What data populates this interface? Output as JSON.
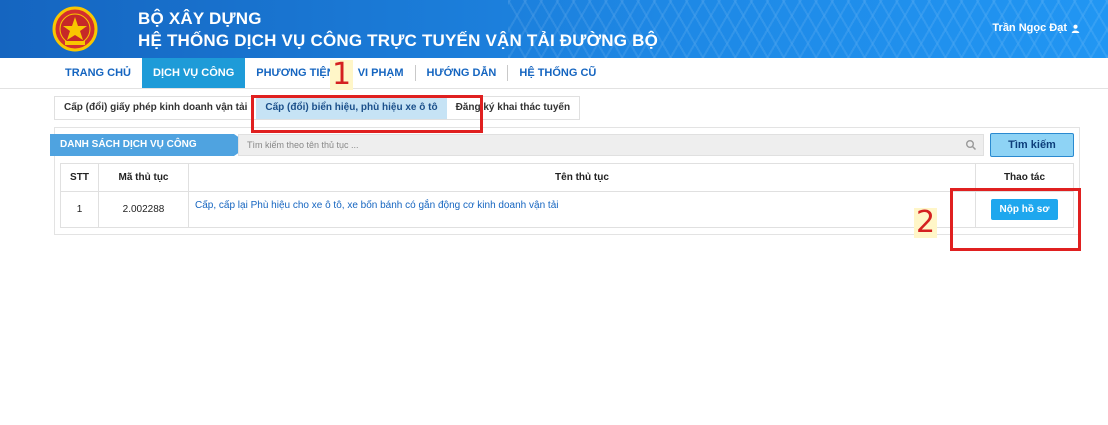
{
  "header": {
    "title_line1": "BỘ XÂY DỰNG",
    "title_line2": "HỆ THỐNG DỊCH VỤ CÔNG TRỰC TUYẾN VẬN TẢI ĐƯỜNG BỘ",
    "user_name": "Trần Ngọc Đạt",
    "user_icon": "user-icon",
    "emblem_icon": "national-emblem-icon"
  },
  "nav": {
    "items": [
      {
        "label": "TRANG CHỦ"
      },
      {
        "label": "DỊCH VỤ CÔNG",
        "active": true
      },
      {
        "label": "PHƯƠNG TIỆN"
      },
      {
        "label": "VI PHẠM"
      },
      {
        "label": "HƯỚNG DẪN"
      },
      {
        "label": "HỆ THỐNG CŨ"
      }
    ]
  },
  "tabs": [
    {
      "label": "Cấp (đổi) giấy phép kinh doanh vận tải"
    },
    {
      "label": "Cấp (đổi) biển hiệu, phù hiệu xe ô tô",
      "active": true
    },
    {
      "label": "Đăng ký khai thác tuyến"
    }
  ],
  "list": {
    "label": "DANH SÁCH DỊCH VỤ CÔNG",
    "search_placeholder": "Tìm kiếm theo tên thủ tục ...",
    "search_button": "Tìm kiếm"
  },
  "table": {
    "headers": [
      "STT",
      "Mã thủ tục",
      "Tên thủ tục",
      "Thao tác"
    ],
    "rows": [
      {
        "stt": "1",
        "code": "2.002288",
        "name": "Cấp, cấp lại Phù hiệu cho xe ô tô, xe bốn bánh có gắn động cơ kinh doanh vận tải",
        "action": "Nộp hồ sơ"
      }
    ]
  },
  "annotations": [
    "1",
    "2"
  ],
  "colors": {
    "header_blue": "#1e88e5",
    "nav_active": "#1e9bd8",
    "link_blue": "#1565c0",
    "annotation_red": "#e02020"
  }
}
